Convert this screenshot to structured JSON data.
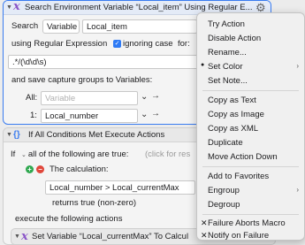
{
  "action1": {
    "title": "Search Environment Variable “Local_item” Using Regular E...",
    "search_label": "Search",
    "variable_popup": "Variable",
    "variable_value": "Local_item",
    "using_label": "using Regular Expression",
    "ignoring_case_label": "ignoring case",
    "for_label": "for:",
    "regex_value": ".*/(\\d\\d\\s)",
    "save_label": "and save capture groups to Variables:",
    "all_label": "All:",
    "all_placeholder": "Variable",
    "group1_label": "1:",
    "group1_value": "Local_number"
  },
  "action2": {
    "title": "If All Conditions Met Execute Actions",
    "if_label": "If",
    "all_popup": "all of the following are true:",
    "click_hint": "(click for res",
    "calc_label": "The calculation:",
    "calc_value": "Local_number > Local_currentMax",
    "returns_text": "returns true (non-zero)",
    "execute_label": "execute the following actions",
    "sub_action_title": "Set Variable “Local_currentMax” To Calcul"
  },
  "menu": {
    "try_action": "Try Action",
    "disable_action": "Disable Action",
    "rename": "Rename...",
    "set_color": "Set Color",
    "set_note": "Set Note...",
    "copy_as_text": "Copy as Text",
    "copy_as_image": "Copy as Image",
    "copy_as_xml": "Copy as XML",
    "duplicate": "Duplicate",
    "move_action_down": "Move Action Down",
    "add_to_favorites": "Add to Favorites",
    "engroup": "Engroup",
    "degroup": "Degroup",
    "failure_aborts": "Failure Aborts Macro",
    "notify_on_failure": "Notify on Failure"
  },
  "icons": {
    "action_icon": "x-variable-icon",
    "group_icon": "braces-icon",
    "gear": "gear-icon",
    "add": "add-condition-icon",
    "remove": "remove-condition-icon"
  },
  "colors": {
    "selection_border": "#3a7cf0",
    "variable_icon": "#8a55c8",
    "add_green": "#2fa84f",
    "remove_red": "#e0463a"
  }
}
